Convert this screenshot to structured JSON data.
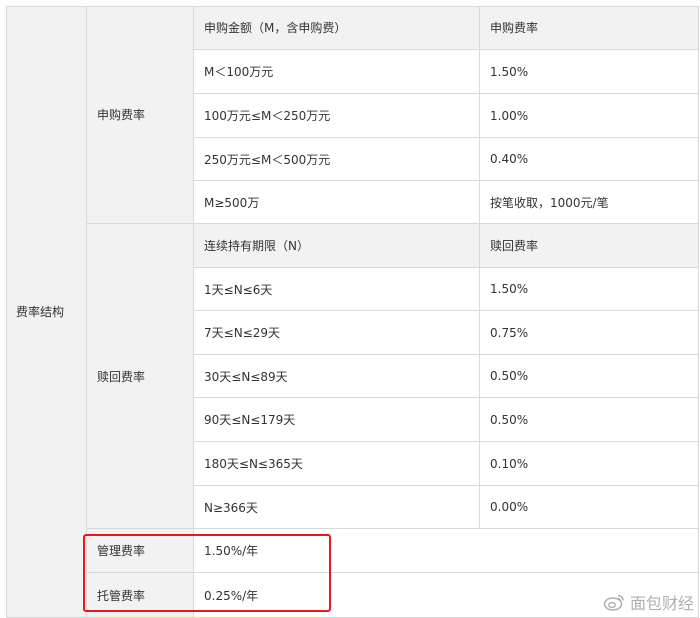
{
  "fee_table": {
    "section_label": "费率结构",
    "subscription": {
      "label": "申购费率",
      "header": {
        "amount": "申购金额（M，含申购费）",
        "rate": "申购费率"
      },
      "rows": [
        {
          "range": "M＜100万元",
          "rate": "1.50%"
        },
        {
          "range": "100万元≤M＜250万元",
          "rate": "1.00%"
        },
        {
          "range": "250万元≤M＜500万元",
          "rate": "0.40%"
        },
        {
          "range": "M≥500万",
          "rate": "按笔收取，1000元/笔"
        }
      ]
    },
    "redemption": {
      "label": "赎回费率",
      "header": {
        "period": "连续持有期限（N）",
        "rate": "赎回费率"
      },
      "rows": [
        {
          "range": "1天≤N≤6天",
          "rate": "1.50%"
        },
        {
          "range": "7天≤N≤29天",
          "rate": "0.75%"
        },
        {
          "range": "30天≤N≤89天",
          "rate": "0.50%"
        },
        {
          "range": "90天≤N≤179天",
          "rate": "0.50%"
        },
        {
          "range": "180天≤N≤365天",
          "rate": "0.10%"
        },
        {
          "range": "N≥366天",
          "rate": "0.00%"
        }
      ]
    },
    "management": {
      "label": "管理费率",
      "value": "1.50%/年"
    },
    "custody": {
      "label": "托管费率",
      "value": "0.25%/年"
    }
  },
  "highlight_color": "#e8191c",
  "watermark": {
    "text": "面包财经",
    "icon": "weibo-icon"
  }
}
